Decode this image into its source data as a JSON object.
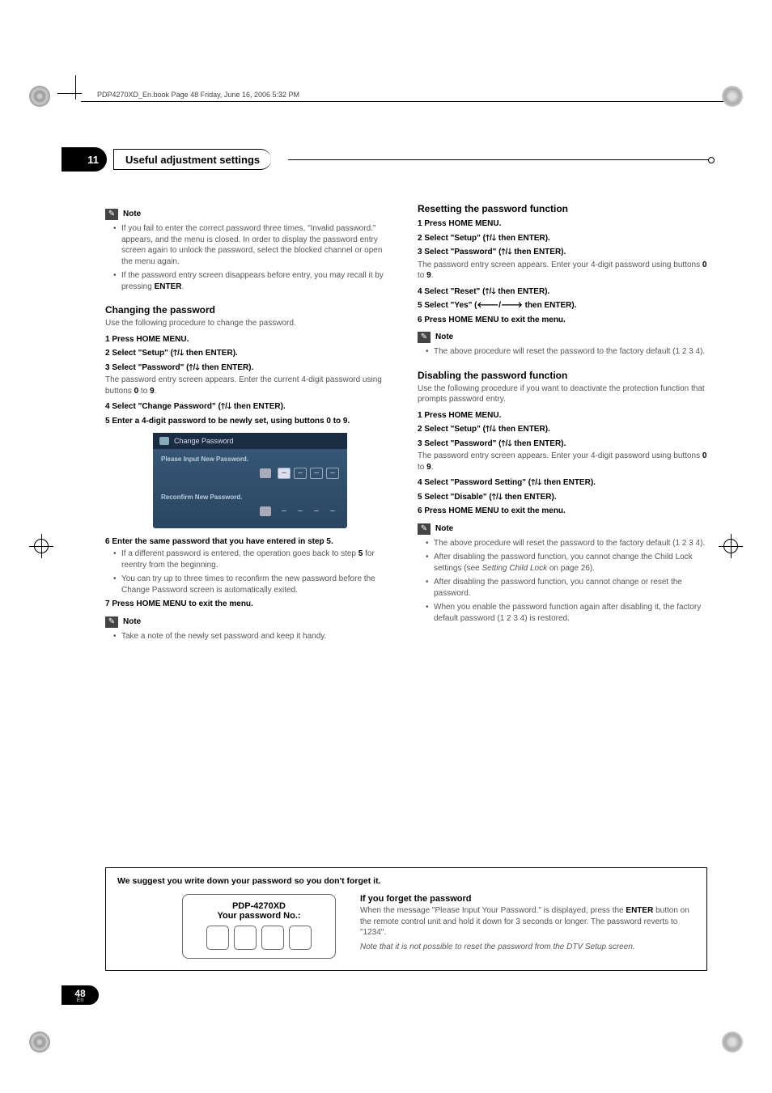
{
  "header": {
    "runner": "PDP4270XD_En.book  Page 48  Friday, June 16, 2006  5:32 PM"
  },
  "chapter": {
    "number": "11",
    "title": "Useful adjustment settings"
  },
  "left": {
    "note1_label": "Note",
    "note1_items": [
      "If you fail to enter the correct password three times, \"Invalid password.\" appears, and the menu is closed. In order to display the password entry screen again to unlock the password, select the blocked channel or open the menu again.",
      "If the password entry screen disappears before entry, you may recall it by pressing "
    ],
    "note1_item2_bold": "ENTER",
    "h_change": "Changing the password",
    "change_intro": "Use the following procedure to change the password.",
    "s1": "1   Press HOME MENU.",
    "s2a": "2   Select \"Setup\" (",
    "s2b": " then ENTER).",
    "s3a": "3   Select \"Password\" (",
    "s3b": " then ENTER).",
    "s3_para_a": "The password entry screen appears. Enter the current 4-digit password using buttons ",
    "s3_para_b": " to ",
    "s3_zero": "0",
    "s3_nine": "9",
    "s4a": "4   Select \"Change Password\" (",
    "s4b": " then ENTER).",
    "s5": "5   Enter a 4-digit password to be newly set, using buttons 0 to 9.",
    "ss_title": "Change Password",
    "ss_row1": "Please Input New Password.",
    "ss_row2": "Reconfirm New Password.",
    "s6": "6   Enter the same password that you have entered in step 5.",
    "s6_b1a": "If a different password is entered, the operation goes back to step ",
    "s6_b1b": " for reentry from the beginning.",
    "s6_b1_bold": "5",
    "s6_b2": "You can try up to three times to reconfirm the new password before the Change Password screen is automatically exited.",
    "s7": "7   Press HOME MENU to exit the menu.",
    "note2_label": "Note",
    "note2_item": "Take a note of the newly set password and keep it handy."
  },
  "right": {
    "h_reset": "Resetting the password function",
    "r1": "1   Press HOME MENU.",
    "r2a": "2   Select \"Setup\" (",
    "r2b": " then ENTER).",
    "r3a": "3   Select \"Password\" (",
    "r3b": " then ENTER).",
    "r3_para_a": "The password entry screen appears. Enter your 4-digit password using buttons ",
    "r3_para_b": " to ",
    "r3_zero": "0",
    "r3_nine": "9",
    "r4a": "4   Select \"Reset\" (",
    "r4b": " then ENTER).",
    "r5a": "5   Select \"Yes\" (",
    "r5b": " then ENTER).",
    "r6": "6   Press HOME MENU to exit the menu.",
    "note1_label": "Note",
    "note1_item": "The above procedure will reset the password to the factory default (1 2 3 4).",
    "h_disable": "Disabling the password function",
    "disable_intro": "Use the following procedure if you want to deactivate the protection function that prompts password entry.",
    "d1": "1   Press HOME MENU.",
    "d2a": "2   Select \"Setup\" (",
    "d2b": " then ENTER).",
    "d3a": "3   Select \"Password\" (",
    "d3b": " then ENTER).",
    "d3_para_a": "The password entry screen appears. Enter your 4-digit password using buttons ",
    "d3_para_b": " to ",
    "d3_zero": "0",
    "d3_nine": "9",
    "d4a": "4   Select \"Password Setting\" (",
    "d4b": " then ENTER).",
    "d5a": "5   Select \"Disable\" (",
    "d5b": " then ENTER).",
    "d6": "6   Press HOME MENU to exit the menu.",
    "note2_label": "Note",
    "note2_items": [
      "The above procedure will reset the password to the factory default (1 2 3 4).",
      "After disabling the password function, you cannot change the Child Lock settings (see ",
      "After disabling the password function, you cannot change or reset the password.",
      "When you enable the password function again after disabling it, the factory default password (1 2 3 4) is restored."
    ],
    "note2_item2_italic": "Setting Child Lock",
    "note2_item2_tail": " on page 26)."
  },
  "footer": {
    "heading": "We suggest you write down your password so you don't forget it.",
    "card_model": "PDP-4270XD",
    "card_label": "Your password No.:",
    "right_h": "If you forget the password",
    "right_p_a": "When the message \"Please Input Your Password.\" is displayed, press the ",
    "right_p_bold": "ENTER",
    "right_p_b": " button on the remote control unit and hold it down for 3 seconds or longer. The password reverts to \"1234\".",
    "right_i": "Note that it is not possible to reset the password from the DTV Setup screen."
  },
  "page": {
    "num": "48",
    "lang": "En"
  },
  "glyphs": {
    "updown": "🡑/🡓",
    "leftright": "🡐/🡒",
    "pencil": "✎"
  }
}
